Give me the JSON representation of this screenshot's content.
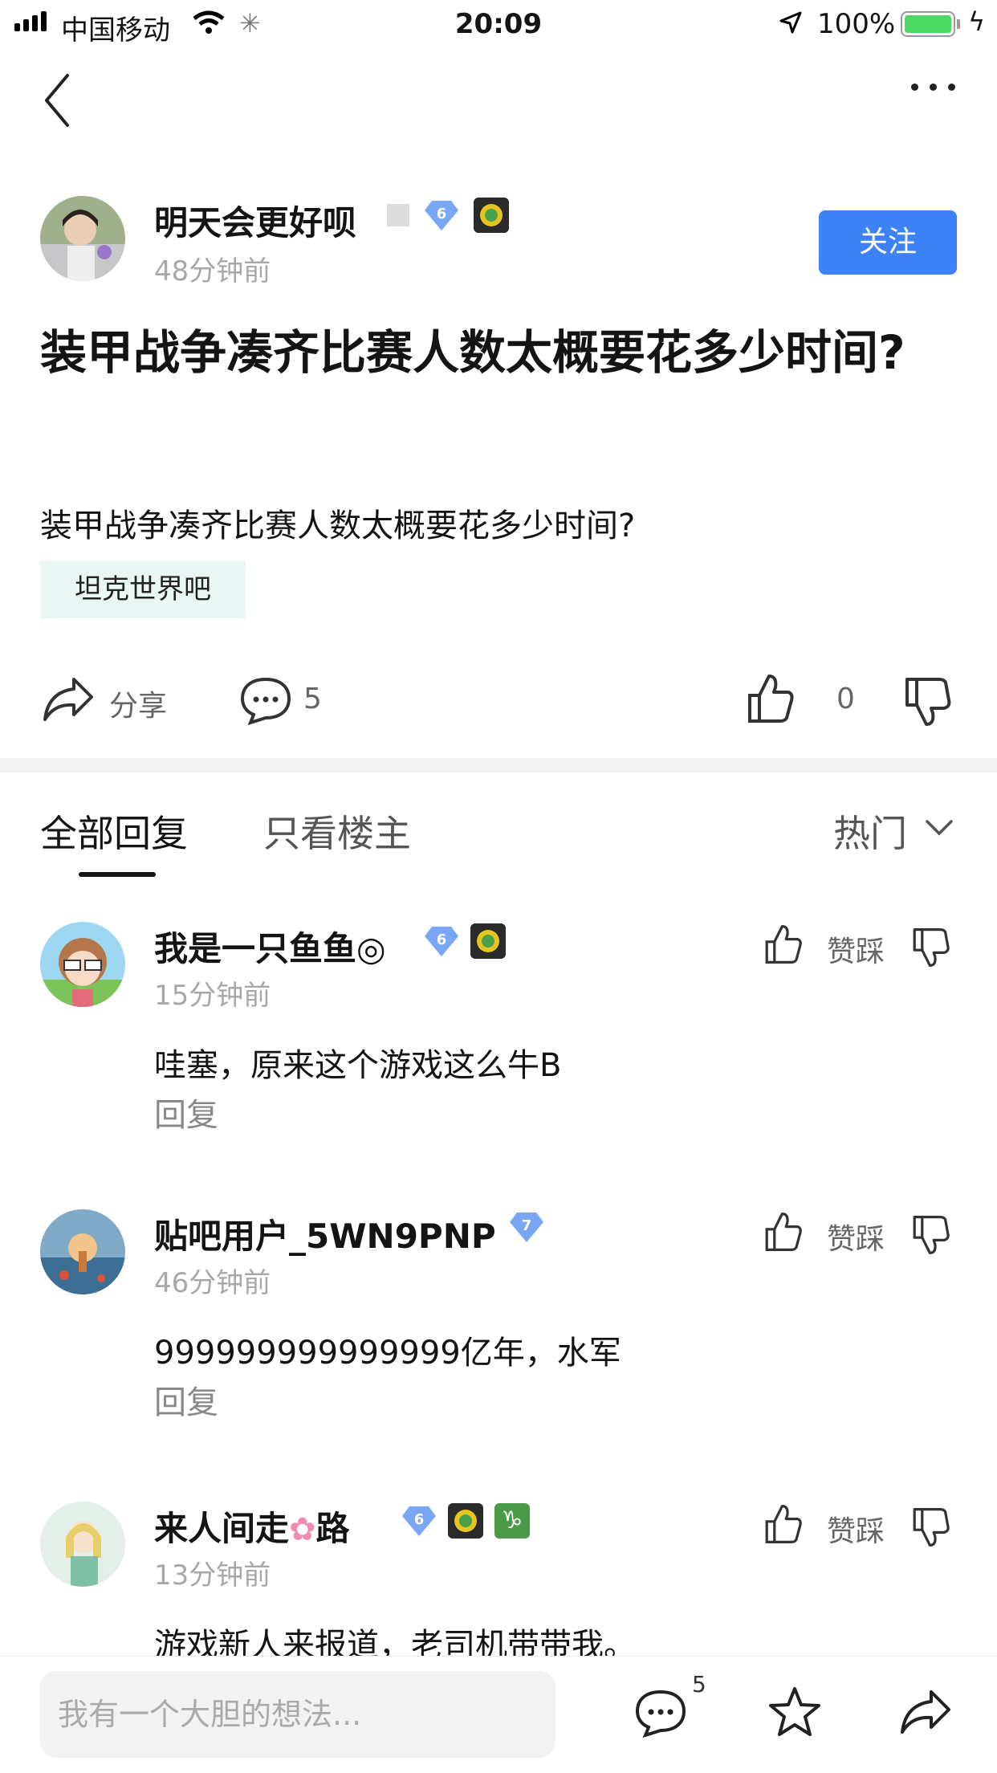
{
  "status_bar": {
    "carrier": "中国移动",
    "time": "20:09",
    "battery": "100%",
    "battery_level": 1.0
  },
  "post": {
    "author": "明天会更好呗",
    "level": "6",
    "time": "48分钟前",
    "follow_label": "关注",
    "title": "装甲战争凑齐比赛人数太概要花多少时间?",
    "body": "装甲战争凑齐比赛人数太概要花多少时间?",
    "forum_tag": "坦克世界吧",
    "share_label": "分享",
    "comment_count": "5",
    "upvote_count": "0"
  },
  "tabs": {
    "all": "全部回复",
    "op_only": "只看楼主",
    "sort": "热门"
  },
  "replies": [
    {
      "name": "我是一只鱼鱼◎",
      "level": "6",
      "time": "15分钟前",
      "text": "哇塞，原来这个游戏这么牛B",
      "reply_label": "回复",
      "vote_label": "赞踩"
    },
    {
      "name": "贴吧用户_5WN9PNP",
      "level": "7",
      "time": "46分钟前",
      "text": "999999999999999亿年，水军",
      "reply_label": "回复",
      "vote_label": "赞踩"
    },
    {
      "name_part1": "来人间走",
      "name_flower": "✿",
      "name_part2": "路",
      "level": "6",
      "zodiac": "♑",
      "time": "13分钟前",
      "text": "游戏新人来报道，老司机带带我。",
      "vote_label": "赞踩"
    }
  ],
  "bottom_bar": {
    "input_placeholder": "我有一个大胆的想法...",
    "comment_count": "5"
  },
  "colors": {
    "accent": "#3e82f7",
    "tag_bg": "#e9f7f4",
    "muted": "#a8a8a8",
    "battery_green": "#4cd964"
  }
}
